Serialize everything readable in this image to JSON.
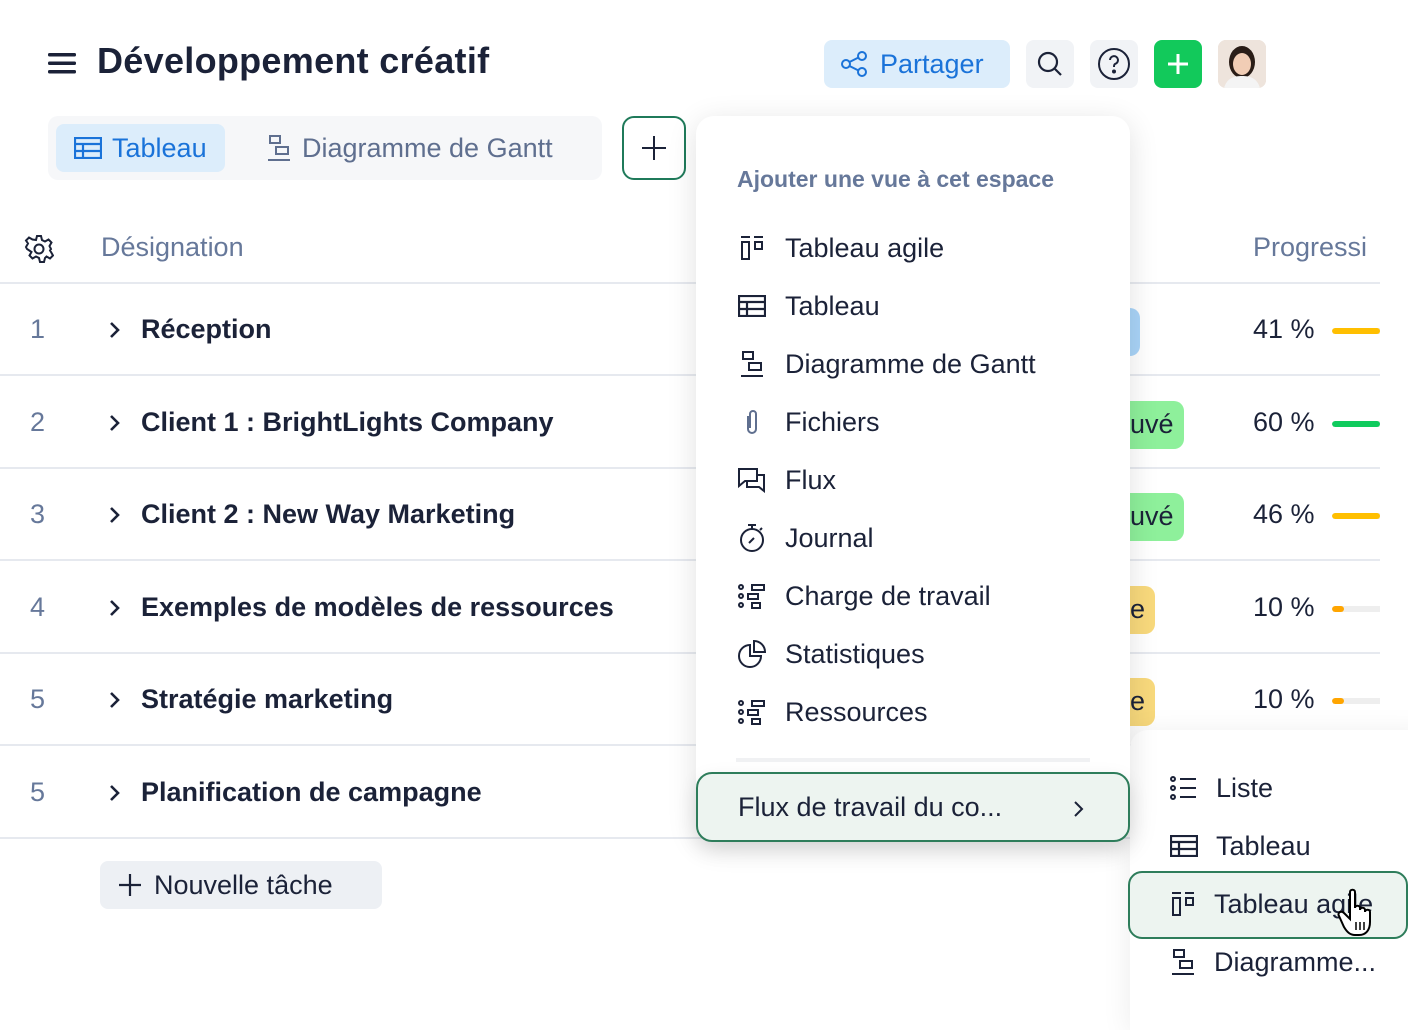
{
  "header": {
    "title": "Développement créatif",
    "share_label": "Partager",
    "icons": [
      "menu-icon",
      "share-icon",
      "search-icon",
      "help-icon",
      "plus-icon",
      "avatar"
    ]
  },
  "view_tabs": [
    {
      "label": "Tableau",
      "icon": "table-icon",
      "active": true
    },
    {
      "label": "Diagramme de Gantt",
      "icon": "gantt-icon",
      "active": false
    }
  ],
  "table": {
    "columns": {
      "designation": "Désignation",
      "progress": "Progressi"
    },
    "rows": [
      {
        "num": "1",
        "name": "Réception",
        "status": "",
        "status_color": "#a9d4f8",
        "progress": "41 %",
        "progress_value": 41,
        "bar_color": "#ffbf00"
      },
      {
        "num": "2",
        "name": "Client 1 : BrightLights Company",
        "status": "uvé",
        "status_color": "#8ef09b",
        "progress": "60 %",
        "progress_value": 60,
        "bar_color": "#0fcb5d"
      },
      {
        "num": "3",
        "name": "Client 2 : New Way Marketing",
        "status": "uvé",
        "status_color": "#8ef09b",
        "progress": "46 %",
        "progress_value": 46,
        "bar_color": "#ffbf00"
      },
      {
        "num": "4",
        "name": "Exemples de modèles de ressources",
        "status": "e",
        "status_color": "#f8d97c",
        "progress": "10 %",
        "progress_value": 10,
        "bar_color": "#ffa500"
      },
      {
        "num": "5",
        "name": "Stratégie marketing",
        "status": "e",
        "status_color": "#f8d97c",
        "progress": "10 %",
        "progress_value": 10,
        "bar_color": "#ffa500"
      },
      {
        "num": "5",
        "name": "Planification de campagne"
      }
    ],
    "new_task_label": "Nouvelle tâche"
  },
  "add_view_menu": {
    "heading": "Ajouter une vue à cet espace",
    "items": [
      {
        "label": "Tableau agile",
        "icon": "kanban-icon"
      },
      {
        "label": "Tableau",
        "icon": "table-icon"
      },
      {
        "label": "Diagramme de Gantt",
        "icon": "gantt-icon"
      },
      {
        "label": "Fichiers",
        "icon": "paperclip-icon"
      },
      {
        "label": "Flux",
        "icon": "chat-icon"
      },
      {
        "label": "Journal",
        "icon": "stopwatch-icon"
      },
      {
        "label": "Charge de travail",
        "icon": "workload-icon"
      },
      {
        "label": "Statistiques",
        "icon": "pie-chart-icon"
      },
      {
        "label": "Ressources",
        "icon": "workload-icon"
      }
    ],
    "workflow_label": "Flux de travail du co..."
  },
  "submenu": {
    "items": [
      {
        "label": "Liste",
        "icon": "list-icon"
      },
      {
        "label": "Tableau",
        "icon": "table-icon"
      },
      {
        "label": "Tableau agile",
        "icon": "kanban-icon",
        "highlighted": true
      },
      {
        "label": "Diagramme...",
        "icon": "gantt-icon"
      }
    ]
  },
  "colors": {
    "accent": "#1a73d9",
    "green": "#12c95b",
    "focus_border": "#2e7d5b"
  }
}
